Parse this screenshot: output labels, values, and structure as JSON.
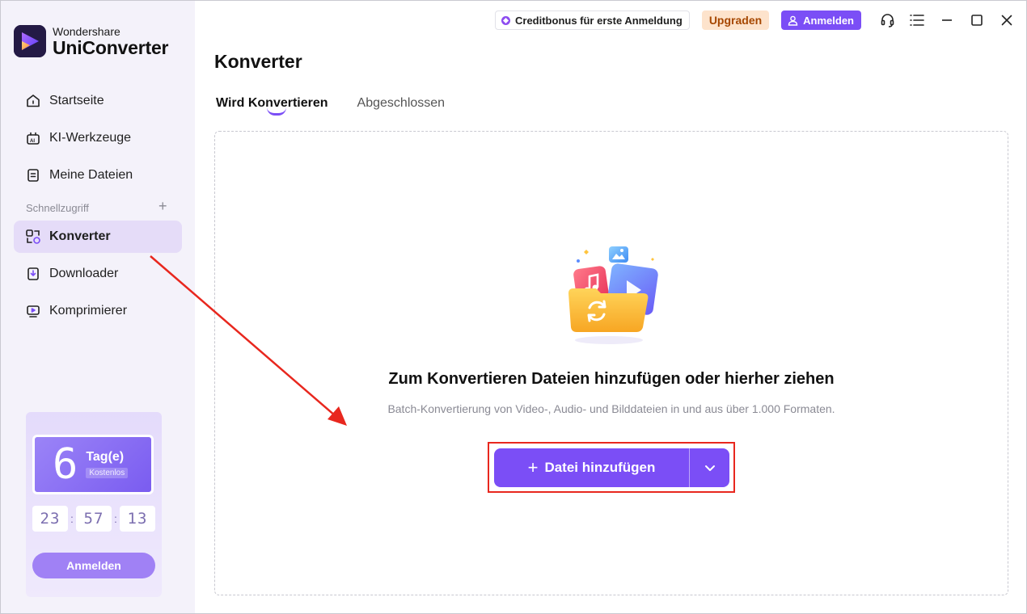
{
  "brand": {
    "company": "Wondershare",
    "product": "UniConverter"
  },
  "sidebar": {
    "items": [
      {
        "label": "Startseite",
        "icon": "home-icon"
      },
      {
        "label": "KI-Werkzeuge",
        "icon": "ai-tools-icon"
      },
      {
        "label": "Meine Dateien",
        "icon": "files-icon"
      }
    ],
    "section_label": "Schnellzugriff",
    "section_add": "+",
    "quick_items": [
      {
        "label": "Konverter",
        "icon": "converter-icon",
        "active": true
      },
      {
        "label": "Downloader",
        "icon": "downloader-icon"
      },
      {
        "label": "Komprimierer",
        "icon": "compressor-icon"
      }
    ]
  },
  "promo": {
    "days_number": "6",
    "days_label": "Tag(e)",
    "free_label": "Kostenlos",
    "timer": {
      "hours": "23",
      "minutes": "57",
      "seconds": "13",
      "separator": ":"
    },
    "button_label": "Anmelden"
  },
  "topbar": {
    "credit_label": "Creditbonus für erste Anmeldung",
    "upgrade_label": "Upgraden",
    "login_label": "Anmelden",
    "icons": [
      "headset-icon",
      "menu-icon",
      "minimize-icon",
      "maximize-icon",
      "close-icon"
    ]
  },
  "main": {
    "title": "Konverter",
    "tabs": [
      {
        "label": "Wird Konvertieren",
        "active": true
      },
      {
        "label": "Abgeschlossen",
        "active": false
      }
    ],
    "drop_title": "Zum Konvertieren Dateien hinzufügen oder hierher ziehen",
    "drop_subtitle": "Batch-Konvertierung von Video-, Audio- und Bilddateien in und aus über 1.000 Formaten.",
    "add_button": {
      "plus": "+",
      "label": "Datei hinzufügen"
    }
  },
  "colors": {
    "accent": "#7b4ef6",
    "sidebar_bg": "#f4f2fa",
    "active_nav": "#e5dcf8",
    "annotation": "#e8271e",
    "upgrade_bg": "#fde3cc",
    "upgrade_text": "#a64700"
  }
}
